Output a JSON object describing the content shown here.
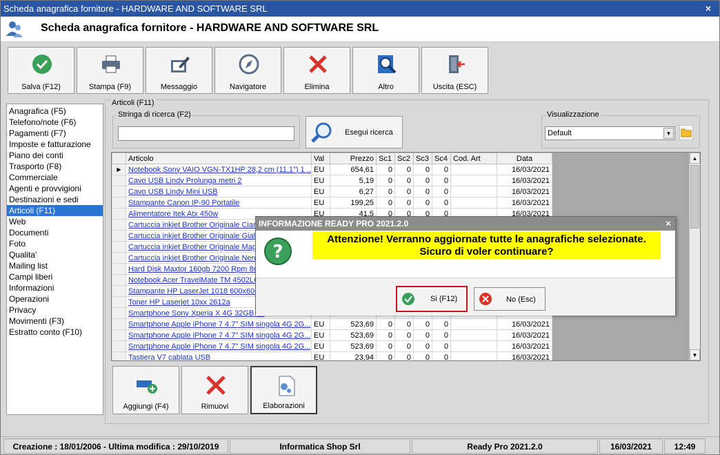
{
  "window": {
    "title": "Scheda anagrafica fornitore - HARDWARE AND SOFTWARE SRL",
    "close_glyph": "×"
  },
  "header": {
    "title": "Scheda anagrafica fornitore - HARDWARE AND SOFTWARE SRL"
  },
  "toolbar": {
    "save": "Salva (F12)",
    "print": "Stampa (F9)",
    "message": "Messaggio",
    "navigator": "Navigatore",
    "delete": "Elimina",
    "other": "Altro",
    "exit": "Uscita (ESC)"
  },
  "sidebar": {
    "items": [
      {
        "label": "Anagrafica (F5)"
      },
      {
        "label": "Telefono/note (F6)"
      },
      {
        "label": "Pagamenti (F7)"
      },
      {
        "label": "Imposte e fatturazione"
      },
      {
        "label": "Piano dei conti"
      },
      {
        "label": "Trasporto (F8)"
      },
      {
        "label": "Commerciale"
      },
      {
        "label": "Agenti e provvigioni"
      },
      {
        "label": "Destinazioni e sedi"
      },
      {
        "label": "Articoli (F11)"
      },
      {
        "label": "Web"
      },
      {
        "label": "Documenti"
      },
      {
        "label": "Foto"
      },
      {
        "label": "Qualita'"
      },
      {
        "label": "Mailing list"
      },
      {
        "label": "Campi liberi"
      },
      {
        "label": "Informazioni"
      },
      {
        "label": "Operazioni"
      },
      {
        "label": "Privacy"
      },
      {
        "label": "Movimenti (F3)"
      },
      {
        "label": "Estratto conto (F10)"
      }
    ],
    "selected": "Articoli (F11)"
  },
  "articles": {
    "group_title": "Articoli (F11)",
    "search_label": "Stringa di ricerca (F2)",
    "search_value": "",
    "search_button": "Esegui ricerca",
    "view_label": "Visualizzazione",
    "view_value": "Default",
    "dropdown_glyph": "▼",
    "columns": [
      "Articolo",
      "Val",
      "Prezzo",
      "Sc1",
      "Sc2",
      "Sc3",
      "Sc4",
      "Cod. Art",
      "Data"
    ],
    "rows": [
      [
        "Notebook Sony VAIO VGN-TX1HP 28,2 cm (11.1\") 1 ...",
        "EU",
        "654,61",
        "0",
        "0",
        "0",
        "0",
        "",
        "16/03/2021"
      ],
      [
        "Cavo USB Lindy Prolunga metri 2",
        "EU",
        "5,19",
        "0",
        "0",
        "0",
        "0",
        "",
        "16/03/2021"
      ],
      [
        "Cavo USB Lindy Mini USB",
        "EU",
        "6,27",
        "0",
        "0",
        "0",
        "0",
        "",
        "16/03/2021"
      ],
      [
        "Stampante Canon IP-90 Portatile",
        "EU",
        "199,25",
        "0",
        "0",
        "0",
        "0",
        "",
        "16/03/2021"
      ],
      [
        "Alimentatore Itek Atx 450w",
        "EU",
        "41,5",
        "0",
        "0",
        "0",
        "0",
        "",
        "16/03/2021"
      ],
      [
        "Cartuccia inkjet Brother Originale Cian",
        "",
        "",
        "",
        "",
        "",
        "",
        "",
        ""
      ],
      [
        "Cartuccia inkjet Brother Originale Giall",
        "",
        "",
        "",
        "",
        "",
        "",
        "",
        ""
      ],
      [
        "Cartuccia inkjet Brother Originale Mage",
        "",
        "",
        "",
        "",
        "",
        "",
        "",
        ""
      ],
      [
        "Cartuccia inkjet Brother Originale Nero",
        "",
        "",
        "",
        "",
        "",
        "",
        "",
        ""
      ],
      [
        "Hard Disk Maxtor 160gb 7200 Rpm 8mb",
        "",
        "",
        "",
        "",
        "",
        "",
        "",
        ""
      ],
      [
        "Notebook Acer TravelMate TM 4502LCI",
        "",
        "",
        "",
        "",
        "",
        "",
        "",
        ""
      ],
      [
        "Stampante HP LaserJet 1018 600x600",
        "",
        "",
        "",
        "",
        "",
        "",
        "",
        ""
      ],
      [
        "Toner HP Laserjet 10xx 2612a",
        "",
        "",
        "",
        "",
        "",
        "",
        "",
        ""
      ],
      [
        "Smartphone Sony Xperia X 4G 32GB Or",
        "",
        "",
        "",
        "",
        "",
        "",
        "",
        ""
      ],
      [
        "Smartphone Apple iPhone 7 4.7\" SIM singola 4G 2G...",
        "EU",
        "523,69",
        "0",
        "0",
        "0",
        "0",
        "",
        "16/03/2021"
      ],
      [
        "Smartphone Apple iPhone 7 4.7\" SIM singola 4G 2G...",
        "EU",
        "523,69",
        "0",
        "0",
        "0",
        "0",
        "",
        "16/03/2021"
      ],
      [
        "Smartphone Apple iPhone 7 4.7\" SIM singola 4G 2G...",
        "EU",
        "523,69",
        "0",
        "0",
        "0",
        "0",
        "",
        "16/03/2021"
      ],
      [
        "Tastiera V7 cablata USB",
        "EU",
        "23,94",
        "0",
        "0",
        "0",
        "0",
        "",
        "16/03/2021"
      ]
    ],
    "selected_row_marker": "▶",
    "add_button": "Aggiungi (F4)",
    "remove_button": "Rimuovi",
    "process_button": "Elaborazioni",
    "scroll_up": "▲",
    "scroll_down": "▼"
  },
  "dialog": {
    "title": "INFORMAZIONE READY PRO 2021.2.0",
    "close_glyph": "×",
    "message_line1": "Attenzione! Verranno aggiornate tutte le anagrafiche selezionate.",
    "message_line2": "Sicuro di voler continuare?",
    "yes_label": "Si (F12)",
    "no_label": "No (Esc)"
  },
  "statusbar": {
    "created": "Creazione : 18/01/2006 - Ultima modifica : 29/10/2019",
    "company": "Informatica Shop Srl",
    "version": "Ready Pro 2021.2.0",
    "date": "16/03/2021",
    "time": "12:49"
  },
  "colors": {
    "titlebar": "#2a55a0",
    "selection": "#2a74d3",
    "dialog_highlight": "#ffff00",
    "link": "#1a33c8",
    "selected_border": "#c01818"
  },
  "icons": {
    "header": "supplier-person-icon",
    "save": "check-circle-icon",
    "print": "printer-icon",
    "message": "compose-icon",
    "navigator": "compass-icon",
    "delete": "red-x-icon",
    "other": "magnifier-document-icon",
    "exit": "exit-door-icon",
    "search": "magnifier-icon",
    "folder": "folder-icon",
    "add": "add-item-icon",
    "remove": "red-x-icon",
    "process": "gear-document-icon",
    "question": "question-icon",
    "yes": "check-circle-icon",
    "no": "cancel-circle-icon"
  }
}
